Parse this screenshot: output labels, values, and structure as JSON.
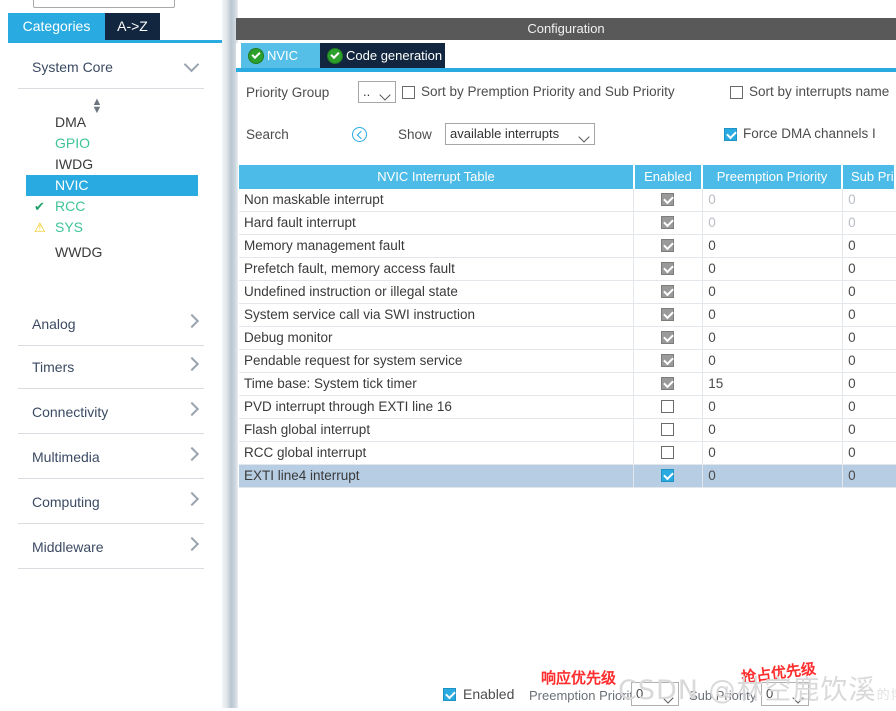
{
  "left_panel": {
    "search_stub_placeholder": "",
    "tabs": [
      {
        "label": "Categories",
        "selected": true
      },
      {
        "label": "A->Z",
        "selected": false
      }
    ],
    "groups": [
      {
        "label": "System Core",
        "expanded": true,
        "icon": "chevron-down-icon"
      },
      {
        "label": "Analog",
        "expanded": false,
        "icon": "chevron-right-icon"
      },
      {
        "label": "Timers",
        "expanded": false,
        "icon": "chevron-right-icon"
      },
      {
        "label": "Connectivity",
        "expanded": false,
        "icon": "chevron-right-icon"
      },
      {
        "label": "Multimedia",
        "expanded": false,
        "icon": "chevron-right-icon"
      },
      {
        "label": "Computing",
        "expanded": false,
        "icon": "chevron-right-icon"
      },
      {
        "label": "Middleware",
        "expanded": false,
        "icon": "chevron-right-icon"
      }
    ],
    "spinner_icon": "up-down-spinner-icon",
    "peripherals": [
      {
        "label": "DMA",
        "mark": "",
        "state": "plain",
        "selected": false
      },
      {
        "label": "GPIO",
        "mark": "",
        "state": "configured",
        "selected": false
      },
      {
        "label": "IWDG",
        "mark": "",
        "state": "plain",
        "selected": false
      },
      {
        "label": "NVIC",
        "mark": "",
        "state": "plain",
        "selected": true
      },
      {
        "label": "RCC",
        "mark": "✔",
        "state": "configured",
        "selected": false
      },
      {
        "label": "SYS",
        "mark": "⚠",
        "state": "warning",
        "selected": false
      },
      {
        "label": "WWDG",
        "mark": "",
        "state": "plain",
        "selected": false
      }
    ]
  },
  "configuration": {
    "title": "Configuration",
    "tabs": [
      {
        "label": "NVIC",
        "selected": true,
        "icon": "check-circle-icon"
      },
      {
        "label": "Code generation",
        "selected": false,
        "icon": "check-circle-icon"
      }
    ],
    "controls": {
      "priority_group_label": "Priority Group",
      "priority_group_value": "..",
      "sort_preemption_label": "Sort by Premption Priority and Sub Priority",
      "sort_preemption_checked": false,
      "sort_name_label": "Sort by interrupts name",
      "sort_name_checked": false,
      "search_label": "Search",
      "search_icon": "search-icon",
      "show_label": "Show",
      "show_value": "available interrupts",
      "force_dma_label": "Force DMA channels I",
      "force_dma_checked": true
    }
  },
  "table": {
    "columns": [
      "NVIC Interrupt Table",
      "Enabled",
      "Preemption Priority",
      "Sub Priority"
    ],
    "rows": [
      {
        "name": "Non maskable interrupt",
        "enabled": true,
        "locked": true,
        "preemption": "0",
        "sub": "0",
        "selected": false
      },
      {
        "name": "Hard fault interrupt",
        "enabled": true,
        "locked": true,
        "preemption": "0",
        "sub": "0",
        "selected": false
      },
      {
        "name": "Memory management fault",
        "enabled": true,
        "locked": true,
        "preemption": "0",
        "sub": "0",
        "selected": false
      },
      {
        "name": "Prefetch fault, memory access fault",
        "enabled": true,
        "locked": true,
        "preemption": "0",
        "sub": "0",
        "selected": false
      },
      {
        "name": "Undefined instruction or illegal state",
        "enabled": true,
        "locked": true,
        "preemption": "0",
        "sub": "0",
        "selected": false
      },
      {
        "name": "System service call via SWI instruction",
        "enabled": true,
        "locked": true,
        "preemption": "0",
        "sub": "0",
        "selected": false
      },
      {
        "name": "Debug monitor",
        "enabled": true,
        "locked": true,
        "preemption": "0",
        "sub": "0",
        "selected": false
      },
      {
        "name": "Pendable request for system service",
        "enabled": true,
        "locked": true,
        "preemption": "0",
        "sub": "0",
        "selected": false
      },
      {
        "name": "Time base: System tick timer",
        "enabled": true,
        "locked": true,
        "preemption": "15",
        "sub": "0",
        "selected": false
      },
      {
        "name": "PVD interrupt through EXTI line 16",
        "enabled": false,
        "locked": false,
        "preemption": "0",
        "sub": "0",
        "selected": false
      },
      {
        "name": "Flash global interrupt",
        "enabled": false,
        "locked": false,
        "preemption": "0",
        "sub": "0",
        "selected": false
      },
      {
        "name": "RCC global interrupt",
        "enabled": false,
        "locked": false,
        "preemption": "0",
        "sub": "0",
        "selected": false
      },
      {
        "name": "EXTI line4 interrupt",
        "enabled": true,
        "locked": false,
        "preemption": "0",
        "sub": "0",
        "selected": true
      }
    ]
  },
  "bottom_bar": {
    "enabled_label": "Enabled",
    "enabled_checked": true,
    "preemption_label": "Preemption Priority",
    "preemption_value": "0",
    "sub_label": "Sub Priority",
    "sub_value": "0"
  },
  "annotations": [
    {
      "text": "响应优先级",
      "color": "#ff2d2d"
    },
    {
      "text": "抢占优先级",
      "color": "#ff2d2d"
    }
  ],
  "watermark": {
    "text": "CSDN @林空鹿饮溪",
    "suffix": "的博客",
    "color": "#d9d9d9"
  }
}
